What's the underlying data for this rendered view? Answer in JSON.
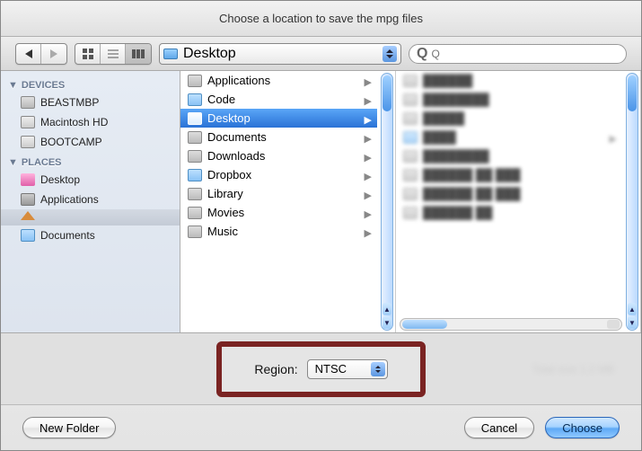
{
  "title": "Choose a location to save the mpg files",
  "toolbar": {
    "path_label": "Desktop",
    "search_placeholder": "Q"
  },
  "sidebar": {
    "sections": [
      {
        "head": "DEVICES",
        "items": [
          {
            "label": "BEASTMBP",
            "icon": "drive"
          },
          {
            "label": "Macintosh HD",
            "icon": "hd"
          },
          {
            "label": "BOOTCAMP",
            "icon": "hd"
          }
        ]
      },
      {
        "head": "PLACES",
        "items": [
          {
            "label": "Desktop",
            "icon": "desktop"
          },
          {
            "label": "Applications",
            "icon": "apps"
          },
          {
            "label": "",
            "icon": "home",
            "selected": true
          },
          {
            "label": "Documents",
            "icon": "folder"
          }
        ]
      }
    ]
  },
  "column": {
    "items": [
      {
        "label": "Applications",
        "icon": "gfolder"
      },
      {
        "label": "Code",
        "icon": "folder"
      },
      {
        "label": "Desktop",
        "icon": "folder",
        "selected": true
      },
      {
        "label": "Documents",
        "icon": "gfolder"
      },
      {
        "label": "Downloads",
        "icon": "gfolder"
      },
      {
        "label": "Dropbox",
        "icon": "folder"
      },
      {
        "label": "Library",
        "icon": "gfolder"
      },
      {
        "label": "Movies",
        "icon": "gfolder"
      },
      {
        "label": "Music",
        "icon": "gfolder"
      }
    ]
  },
  "region": {
    "label": "Region:",
    "value": "NTSC"
  },
  "buttons": {
    "new_folder": "New Folder",
    "cancel": "Cancel",
    "choose": "Choose"
  }
}
